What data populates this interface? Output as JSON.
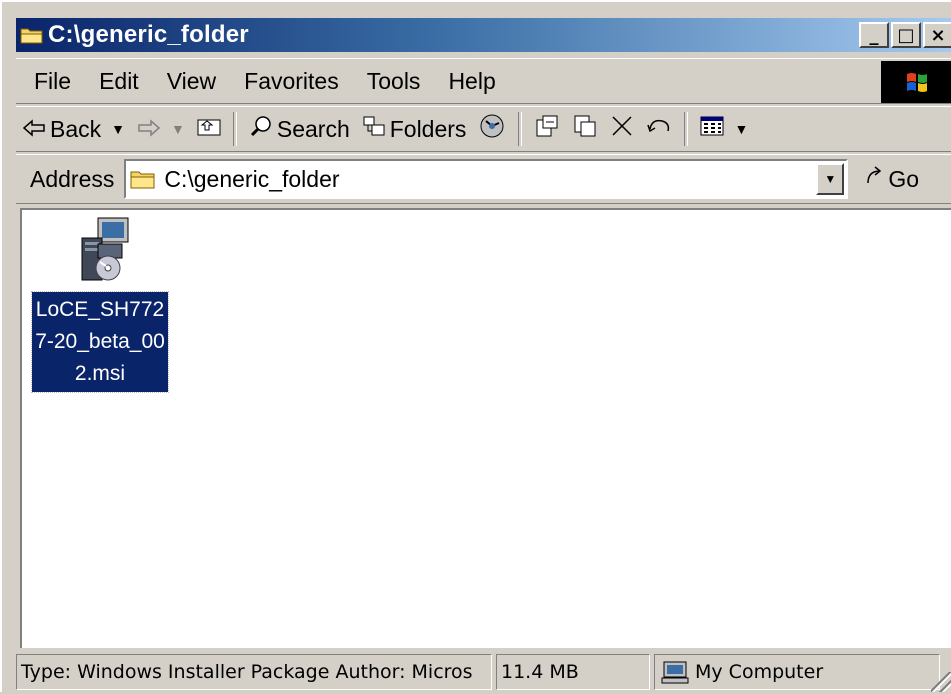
{
  "window": {
    "title": "C:\\generic_folder",
    "minimize_label": "_",
    "maximize_label": "□",
    "close_label": "×"
  },
  "menu": {
    "items": [
      "File",
      "Edit",
      "View",
      "Favorites",
      "Tools",
      "Help"
    ]
  },
  "toolbar": {
    "back_label": "Back",
    "search_label": "Search",
    "folders_label": "Folders"
  },
  "address": {
    "label": "Address",
    "value": "C:\\generic_folder",
    "go_label": "Go"
  },
  "files": [
    {
      "name": "LoCE_SH7727-20_beta_002.msi",
      "selected": true,
      "icon": "msi-installer-icon"
    }
  ],
  "status": {
    "description": "Type: Windows Installer Package Author: Micros",
    "size": "11.4 MB",
    "zone": "My Computer"
  },
  "colors": {
    "titlebar_start": "#0a246a",
    "titlebar_end": "#a6caf0",
    "selection": "#0a246a",
    "face": "#d4d0c8"
  }
}
